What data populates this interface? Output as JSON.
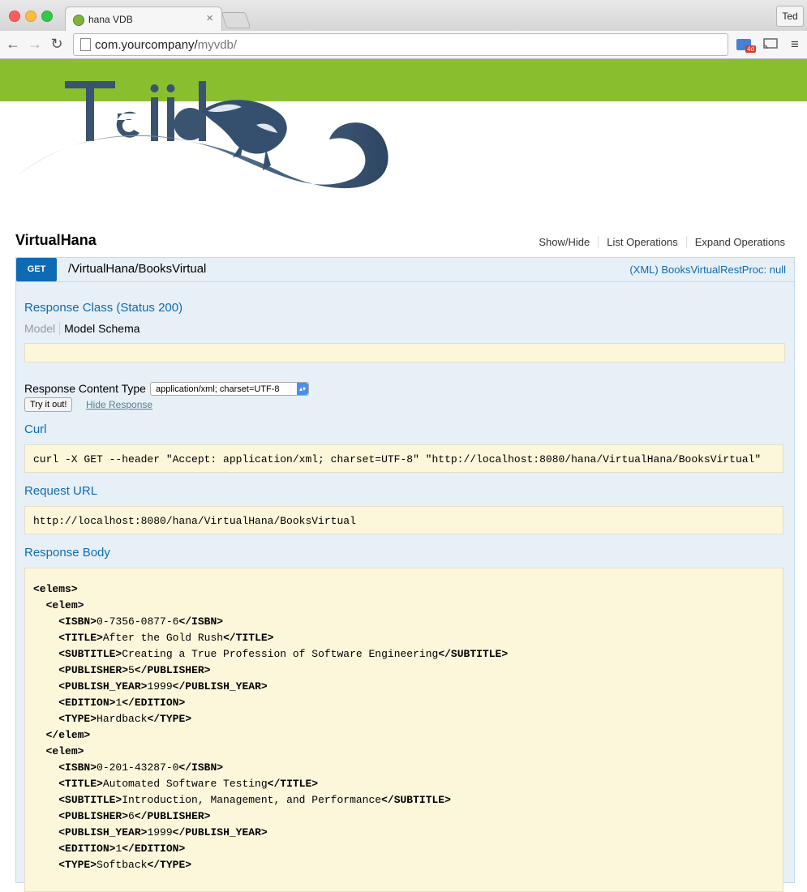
{
  "browser": {
    "tab_title": "hana VDB",
    "tab_close": "×",
    "profile": "Ted",
    "url_host": "com.yourcompany/",
    "url_path": "myvdb/",
    "back": "←",
    "forward": "→",
    "reload": "↻",
    "menu": "≡",
    "ext_badge": "4d",
    "cast": "⌂"
  },
  "logo_text": "Teiid",
  "resource": {
    "title": "VirtualHana",
    "links": [
      "Show/Hide",
      "List Operations",
      "Expand Operations"
    ]
  },
  "operation": {
    "method": "GET",
    "path": "/VirtualHana/BooksVirtual",
    "summary": "(XML) BooksVirtualRestProc: null",
    "response_class": "Response Class (Status 200)",
    "model_tab": "Model",
    "model_schema_tab": "Model Schema",
    "response_content_type_label": "Response Content Type",
    "response_content_type_value": "application/xml; charset=UTF-8",
    "try_button": "Try it out!",
    "hide_response": "Hide Response",
    "curl_heading": "Curl",
    "curl": "curl -X GET --header \"Accept: application/xml; charset=UTF-8\" \"http://localhost:8080/hana/VirtualHana/BooksVirtual\"",
    "request_url_heading": "Request URL",
    "request_url": "http://localhost:8080/hana/VirtualHana/BooksVirtual",
    "response_body_heading": "Response Body",
    "response_body_lines": [
      {
        "indent": "",
        "open": "<elems>",
        "text": "",
        "close": ""
      },
      {
        "indent": "  ",
        "open": "<elem>",
        "text": "",
        "close": ""
      },
      {
        "indent": "    ",
        "open": "<ISBN>",
        "text": "0-7356-0877-6",
        "close": "</ISBN>"
      },
      {
        "indent": "    ",
        "open": "<TITLE>",
        "text": "After the Gold Rush",
        "close": "</TITLE>"
      },
      {
        "indent": "    ",
        "open": "<SUBTITLE>",
        "text": "Creating a True Profession of Software Engineering",
        "close": "</SUBTITLE>"
      },
      {
        "indent": "    ",
        "open": "<PUBLISHER>",
        "text": "5",
        "close": "</PUBLISHER>"
      },
      {
        "indent": "    ",
        "open": "<PUBLISH_YEAR>",
        "text": "1999",
        "close": "</PUBLISH_YEAR>"
      },
      {
        "indent": "    ",
        "open": "<EDITION>",
        "text": "1",
        "close": "</EDITION>"
      },
      {
        "indent": "    ",
        "open": "<TYPE>",
        "text": "Hardback",
        "close": "</TYPE>"
      },
      {
        "indent": "  ",
        "open": "</elem>",
        "text": "",
        "close": ""
      },
      {
        "indent": "  ",
        "open": "<elem>",
        "text": "",
        "close": ""
      },
      {
        "indent": "    ",
        "open": "<ISBN>",
        "text": "0-201-43287-0",
        "close": "</ISBN>"
      },
      {
        "indent": "    ",
        "open": "<TITLE>",
        "text": "Automated Software Testing",
        "close": "</TITLE>"
      },
      {
        "indent": "    ",
        "open": "<SUBTITLE>",
        "text": "Introduction, Management, and Performance",
        "close": "</SUBTITLE>"
      },
      {
        "indent": "    ",
        "open": "<PUBLISHER>",
        "text": "6",
        "close": "</PUBLISHER>"
      },
      {
        "indent": "    ",
        "open": "<PUBLISH_YEAR>",
        "text": "1999",
        "close": "</PUBLISH_YEAR>"
      },
      {
        "indent": "    ",
        "open": "<EDITION>",
        "text": "1",
        "close": "</EDITION>"
      },
      {
        "indent": "    ",
        "open": "<TYPE>",
        "text": "Softback",
        "close": "</TYPE>"
      }
    ]
  },
  "colors": {
    "green_bar": "#89bf2f",
    "method_get": "#0f6ab4",
    "panel_bg": "#e7f0f7",
    "code_bg": "#fcf6db"
  }
}
